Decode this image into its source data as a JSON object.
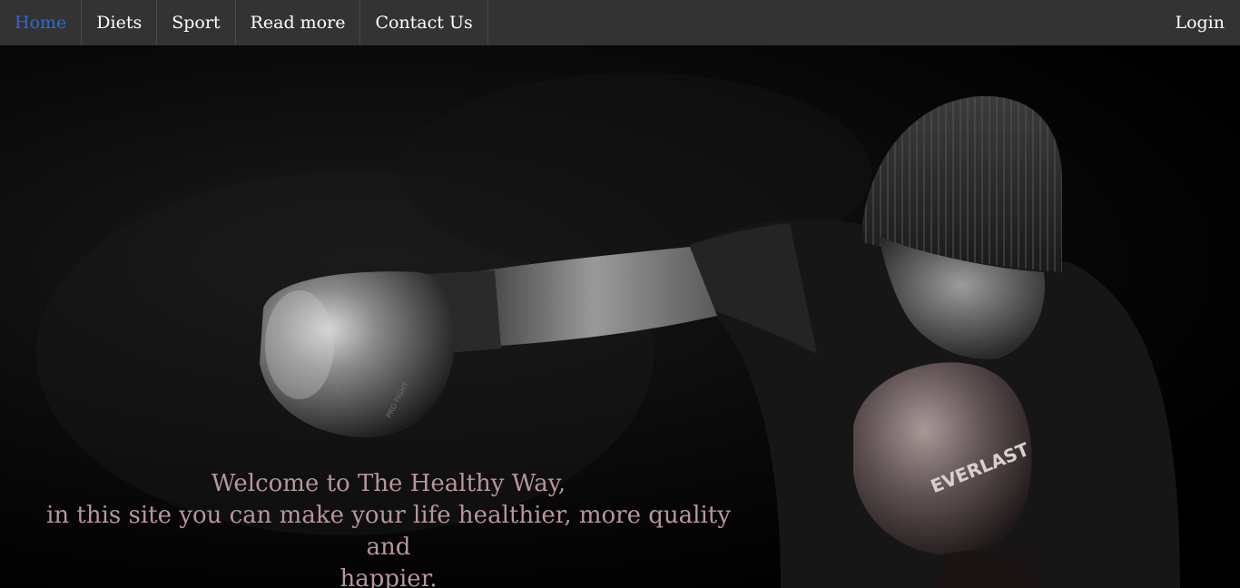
{
  "nav": {
    "items": [
      {
        "label": "Home",
        "active": true
      },
      {
        "label": "Diets",
        "active": false
      },
      {
        "label": "Sport",
        "active": false
      },
      {
        "label": "Read more",
        "active": false
      },
      {
        "label": "Contact Us",
        "active": false
      }
    ],
    "login_label": "Login"
  },
  "hero": {
    "welcome_line1": "Welcome to The Healthy Way,",
    "welcome_line2": "in this site you can make your life healthier, more quality and",
    "welcome_line3": "happier.",
    "glove_brand_left": "PRO FIGHT",
    "glove_brand_right": "EVERLAST"
  },
  "colors": {
    "nav_bg": "#333333",
    "nav_active": "#2a6bd4",
    "welcome_text": "#b8959a"
  }
}
